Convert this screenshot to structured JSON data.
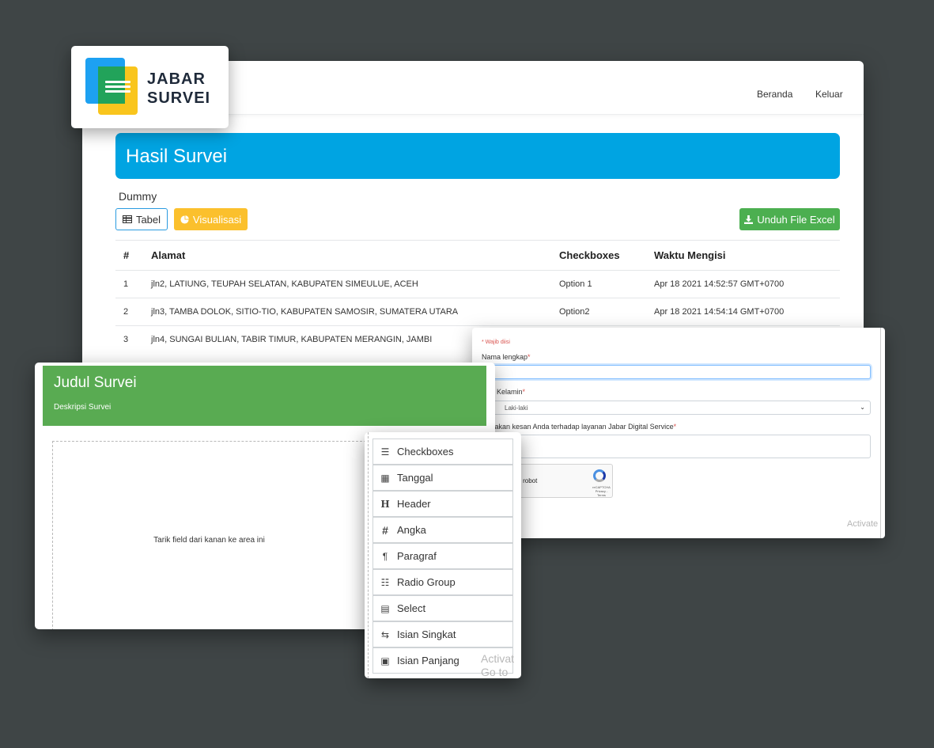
{
  "nav": {
    "beranda": "Beranda",
    "keluar": "Keluar"
  },
  "logo": {
    "line1": "JABAR",
    "line2": "SURVEI"
  },
  "results": {
    "title": "Hasil Survei",
    "survey_name": "Dummy",
    "buttons": {
      "tabel": "Tabel",
      "visualisasi": "Visualisasi",
      "unduh": "Unduh File Excel"
    },
    "table": {
      "headers": [
        "#",
        "Alamat",
        "Checkboxes",
        "Waktu Mengisi"
      ],
      "rows": [
        [
          "1",
          "jln2, LATIUNG, TEUPAH SELATAN, KABUPATEN SIMEULUE, ACEH",
          "Option 1",
          "Apr 18 2021 14:52:57 GMT+0700"
        ],
        [
          "2",
          "jln3, TAMBA DOLOK, SITIO-TIO, KABUPATEN SAMOSIR, SUMATERA UTARA",
          "Option2",
          "Apr 18 2021 14:54:14 GMT+0700"
        ],
        [
          "3",
          "jln4, SUNGAI BULIAN, TABIR TIMUR, KABUPATEN MERANGIN, JAMBI",
          "",
          ""
        ]
      ]
    }
  },
  "builder": {
    "title": "Judul Survei",
    "description": "Deskripsi Survei",
    "drop_hint": "Tarik field dari kanan ke area ini"
  },
  "palette": {
    "fields": [
      {
        "label": "Checkboxes",
        "icon": "list-check-icon"
      },
      {
        "label": "Tanggal",
        "icon": "calendar-icon"
      },
      {
        "label": "Header",
        "icon": "heading-icon"
      },
      {
        "label": "Angka",
        "icon": "hash-icon"
      },
      {
        "label": "Paragraf",
        "icon": "paragraph-icon"
      },
      {
        "label": "Radio Group",
        "icon": "list-radio-icon"
      },
      {
        "label": "Select",
        "icon": "select-icon"
      },
      {
        "label": "Isian Singkat",
        "icon": "short-text-icon"
      },
      {
        "label": "Isian Panjang",
        "icon": "long-text-icon"
      }
    ],
    "watermark_1": "Activat",
    "watermark_2": "Go to Se"
  },
  "form": {
    "required_note": "* Wajib diisi",
    "name_label": "Nama lengkap",
    "gender_label": "s Kelamin",
    "gender_value": "Laki-laki",
    "impression_label": "takan kesan Anda terhadap layanan Jabar Digital Service",
    "captcha_text": "t a robot",
    "captcha_brand": "reCAPTCHA",
    "captcha_terms": "Privacy - Terms",
    "watermark": "Activate"
  },
  "colors": {
    "banner": "#00a4e2",
    "builder_header": "#59ab52",
    "excel_button": "#4caf50",
    "visual_button": "#fbc02d",
    "background": "#3f4546"
  }
}
